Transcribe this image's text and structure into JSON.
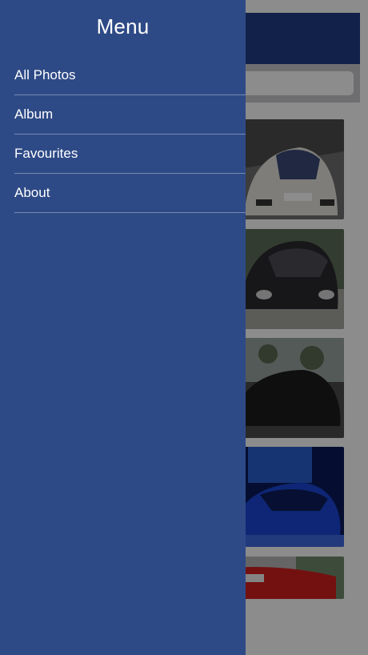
{
  "drawer": {
    "title": "Menu",
    "items": [
      {
        "label": "All Photos"
      },
      {
        "label": "Album"
      },
      {
        "label": "Favourites"
      },
      {
        "label": "About"
      }
    ]
  },
  "colors": {
    "drawer_bg": "#2e4a86",
    "navbar_bg": "#1f3d86",
    "text": "#ffffff"
  }
}
